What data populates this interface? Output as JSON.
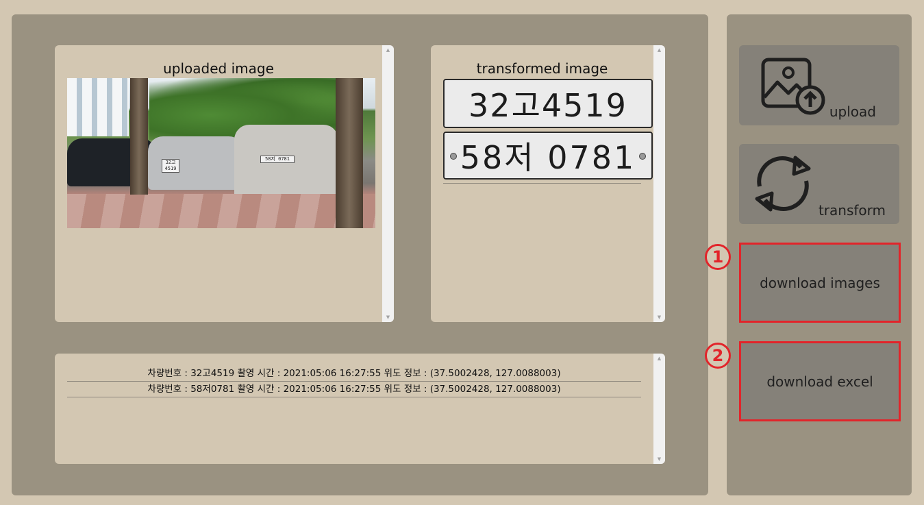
{
  "uploaded_panel": {
    "title": "uploaded image"
  },
  "transformed_panel": {
    "title": "transformed image",
    "plates": [
      "32고4519",
      "58저 0781"
    ]
  },
  "results": {
    "rows": [
      "차량번호 : 32고4519 촬영 시간 : 2021:05:06 16:27:55 위도 정보 : (37.5002428, 127.0088003)",
      "차량번호 : 58저0781 촬영 시간 : 2021:05:06 16:27:55 위도 정보 : (37.5002428, 127.0088003)"
    ]
  },
  "photo_plates": [
    "32고4519",
    "58저 0781"
  ],
  "sidebar": {
    "upload_label": "upload",
    "transform_label": "transform",
    "download_images_label": "download images",
    "download_excel_label": "download excel",
    "marker_1": "1",
    "marker_2": "2"
  },
  "colors": {
    "background": "#d3c7b2",
    "panel": "#9a9281",
    "button": "#858179",
    "highlight": "#e2242a"
  }
}
